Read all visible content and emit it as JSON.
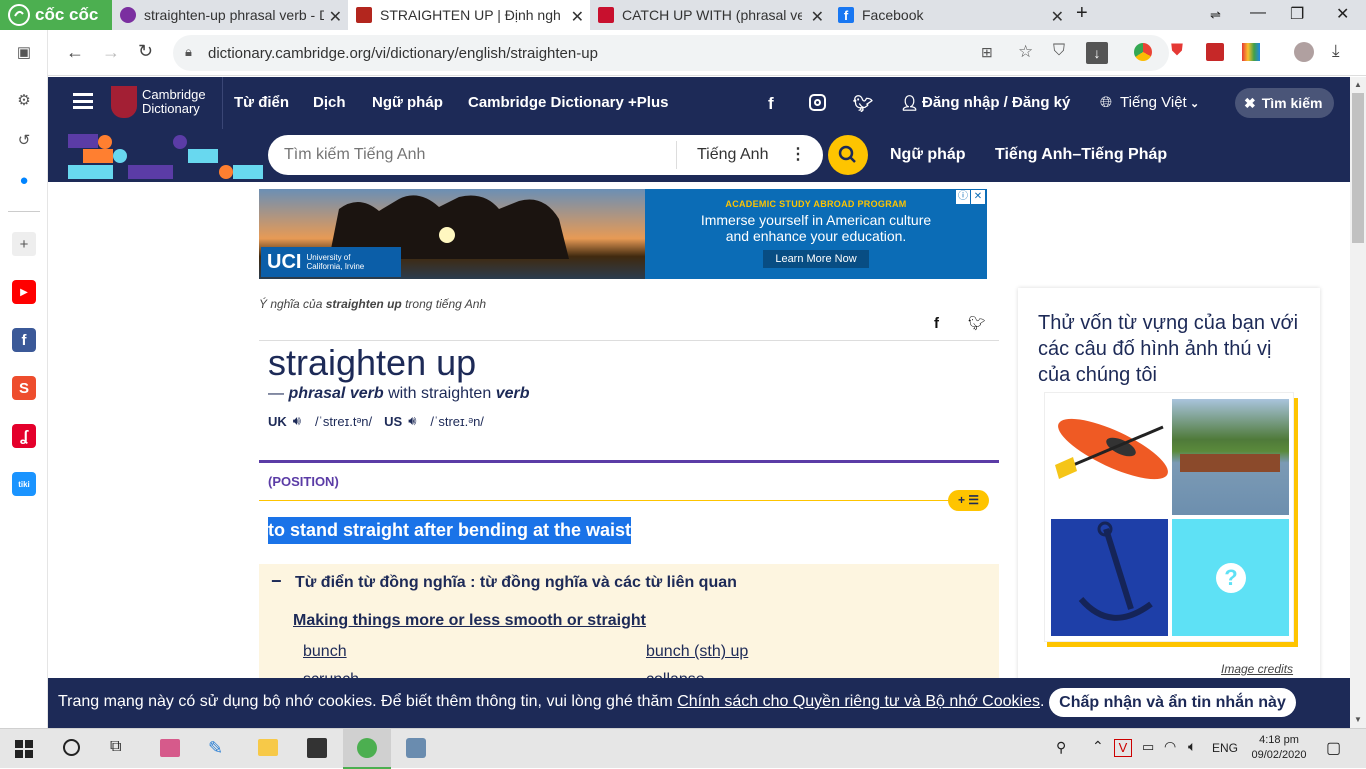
{
  "browser": {
    "brand": "cốc cốc",
    "tabs": [
      {
        "title": "straighten-up phrasal verb - D",
        "icon": "wordreference-icon"
      },
      {
        "title": "STRAIGHTEN UP | Định nghĩa",
        "icon": "cambridge-icon"
      },
      {
        "title": "CATCH UP WITH (phrasal verb",
        "icon": "macmillan-icon"
      },
      {
        "title": "Facebook",
        "icon": "facebook-icon"
      }
    ],
    "new_tab": "+",
    "url": "dictionary.cambridge.org/vi/dictionary/english/straighten-up"
  },
  "site": {
    "logo_line1": "Cambridge",
    "logo_line2": "Dictionary",
    "nav": [
      "Từ điển",
      "Dịch",
      "Ngữ pháp",
      "Cambridge Dictionary +Plus"
    ],
    "login": "Đăng nhập / Đăng ký",
    "language": "Tiếng Việt",
    "search_toggle": "Tìm kiếm",
    "search_placeholder": "Tìm kiếm Tiếng Anh",
    "search_lang": "Tiếng Anh",
    "links": [
      "Ngữ pháp",
      "Tiếng Anh–Tiếng Pháp"
    ]
  },
  "ad": {
    "brand": "UCI",
    "brand_sub1": "University of",
    "brand_sub2": "California, Irvine",
    "kicker": "ACADEMIC STUDY ABROAD PROGRAM",
    "line1": "Immerse yourself in American culture",
    "line2": "and enhance your education.",
    "cta": "Learn More Now"
  },
  "entry": {
    "meaning_prefix": "Ý nghĩa của",
    "meaning_word": "straighten up",
    "meaning_suffix": "trong tiếng Anh",
    "headword": "straighten up",
    "dash": "—",
    "pos": "phrasal verb",
    "with": "with straighten",
    "pos2": "verb",
    "uk": "UK",
    "uk_ipa": "/ˈstreɪ.tᵊn/",
    "us": "US",
    "us_ipa": "/ˈstreɪ.ᵊn/",
    "guideword": "(POSITION)",
    "add_btn": "+ ☰",
    "definition": "to stand straight after bending at the waist"
  },
  "thesaurus": {
    "toggle": "−",
    "title": "Từ điển từ đồng nghĩa : từ đồng nghĩa và các từ liên quan",
    "group": "Making things more or less smooth or straight",
    "words_left": [
      "bunch",
      "scrunch"
    ],
    "words_right": [
      "bunch (sth) up",
      "collapse"
    ]
  },
  "quiz": {
    "title": "Thử vốn từ vựng của bạn với các câu đố hình ảnh thú vị của chúng tôi",
    "credits": "Image credits",
    "question_mark": "?"
  },
  "cookie": {
    "text": "Trang mạng này có sử dụng bộ nhớ cookies. Để biết thêm thông tin, vui lòng ghé thăm",
    "link": "Chính sách cho Quyền riêng tư và Bộ nhớ Cookies",
    "period": ".",
    "accept": "Chấp nhận và ẩn tin nhắn này"
  },
  "taskbar": {
    "lang": "ENG",
    "time": "4:18 pm",
    "date": "09/02/2020"
  },
  "colors": {
    "navy": "#1d2a57",
    "yellow": "#fec400",
    "highlight": "#1a73e8",
    "purple": "#5b3ca6",
    "thesaurus_bg": "#fdf5e0"
  }
}
